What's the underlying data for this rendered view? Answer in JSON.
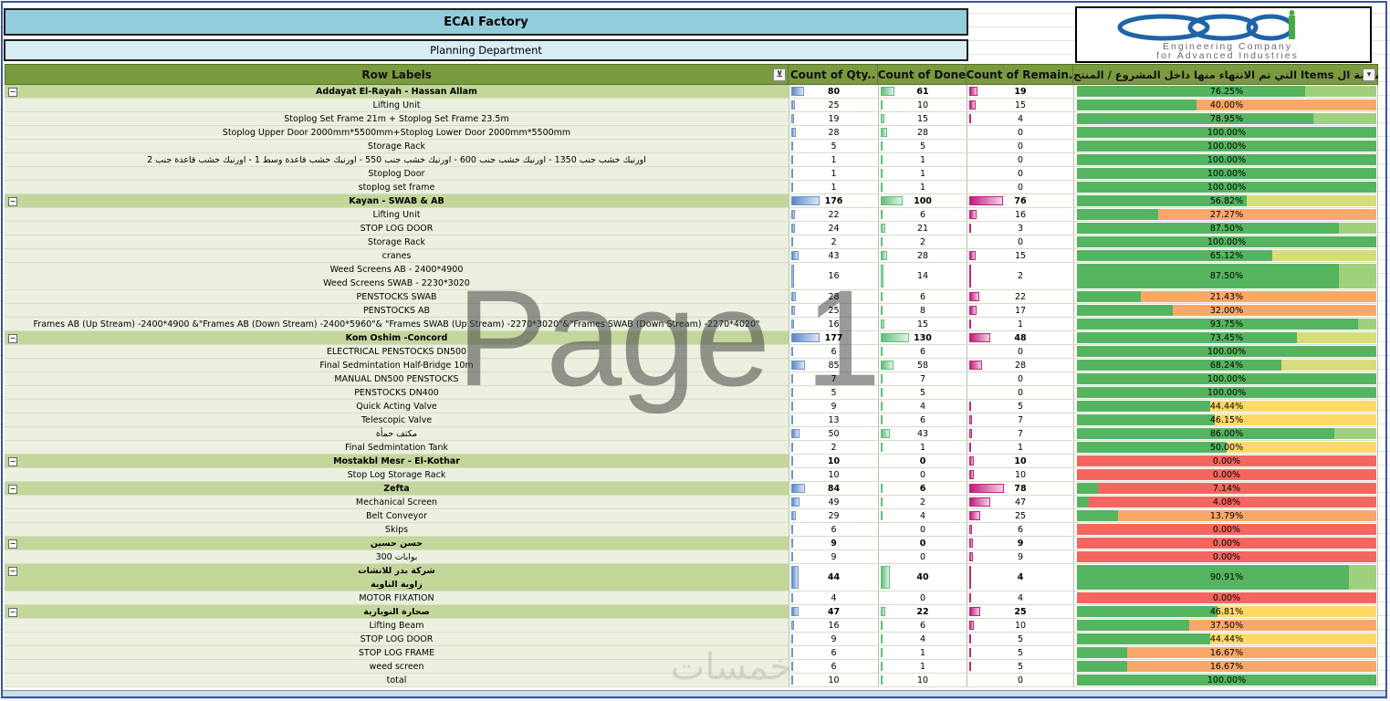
{
  "title": "ECAI Factory",
  "subtitle": "Planning Department",
  "logo": {
    "line1": "Engineering Company",
    "line2": "for Advanced Industries",
    "icon": "ecai-logo-icon",
    "colors": {
      "blue": "#1f63a8",
      "green": "#48a949"
    }
  },
  "headers": {
    "row_labels": "Row Labels",
    "qty": "Count of Qty..",
    "done": "Count of Done",
    "remain": "Count of Remain.",
    "pct": "نسبة ال Items التي تم الانتهاء منها داخل المشروع / المنتج",
    "filter_icon": "filter-icon",
    "dropdown_icon": "chevron-down-icon"
  },
  "max": {
    "qty": 177,
    "done": 130,
    "remain": 78
  },
  "rows": [
    {
      "type": "group",
      "label": "Addayat El-Rayah - Hassan Allam",
      "qty": 80,
      "done": 61,
      "remain": 19,
      "pct": "76.25%",
      "p": 76.25
    },
    {
      "type": "item",
      "label": "Lifting Unit",
      "qty": 25,
      "done": 10,
      "remain": 15,
      "pct": "40.00%",
      "p": 40
    },
    {
      "type": "item",
      "label": "Stoplog Set Frame 21m + Stoplog Set Frame 23.5m",
      "qty": 19,
      "done": 15,
      "remain": 4,
      "pct": "78.95%",
      "p": 78.95
    },
    {
      "type": "item",
      "label": "Stoplog Upper Door 2000mm*5500mm+Stoplog Lower Door 2000mm*5500mm",
      "qty": 28,
      "done": 28,
      "remain": 0,
      "pct": "100.00%",
      "p": 100
    },
    {
      "type": "item",
      "label": "Storage Rack",
      "qty": 5,
      "done": 5,
      "remain": 0,
      "pct": "100.00%",
      "p": 100
    },
    {
      "type": "item",
      "label": "اورنيك خشب جنب 1350 - اورنيك خشب جنب 600 - اورنيك خشب جنب 550 - اورنيك خشب قاعدة وسط 1 - اورنيك خشب قاعدة جنب 2",
      "qty": 1,
      "done": 1,
      "remain": 0,
      "pct": "100.00%",
      "p": 100
    },
    {
      "type": "item",
      "label": "Stoplog Door",
      "qty": 1,
      "done": 1,
      "remain": 0,
      "pct": "100.00%",
      "p": 100
    },
    {
      "type": "item",
      "label": "stoplog set frame",
      "qty": 1,
      "done": 1,
      "remain": 0,
      "pct": "100.00%",
      "p": 100
    },
    {
      "type": "group",
      "label": "Kayan - SWAB & AB",
      "qty": 176,
      "done": 100,
      "remain": 76,
      "pct": "56.82%",
      "p": 56.82
    },
    {
      "type": "item",
      "label": "Lifting Unit",
      "qty": 22,
      "done": 6,
      "remain": 16,
      "pct": "27.27%",
      "p": 27.27
    },
    {
      "type": "item",
      "label": "STOP LOG DOOR",
      "qty": 24,
      "done": 21,
      "remain": 3,
      "pct": "87.50%",
      "p": 87.5
    },
    {
      "type": "item",
      "label": "Storage Rack",
      "qty": 2,
      "done": 2,
      "remain": 0,
      "pct": "100.00%",
      "p": 100
    },
    {
      "type": "item",
      "label": "cranes",
      "qty": 43,
      "done": 28,
      "remain": 15,
      "pct": "65.12%",
      "p": 65.12
    },
    {
      "type": "item",
      "tall": true,
      "label": "Weed Screens AB - 2400*4900",
      "label2": "Weed Screens SWAB - 2230*3020",
      "qty": 16,
      "done": 14,
      "remain": 2,
      "pct": "87.50%",
      "p": 87.5
    },
    {
      "type": "item",
      "label": "PENSTOCKS SWAB",
      "qty": 28,
      "done": 6,
      "remain": 22,
      "pct": "21.43%",
      "p": 21.43
    },
    {
      "type": "item",
      "label": "PENSTOCKS AB",
      "qty": 25,
      "done": 8,
      "remain": 17,
      "pct": "32.00%",
      "p": 32
    },
    {
      "type": "item",
      "label": "Frames AB (Up Stream)  -2400*4900 &\"Frames AB (Down Stream) -2400*5960\"& \"Frames SWAB (Up Stream)  -2270*3020\"&\"Frames SWAB (Down Stream) -2270*4020\"",
      "qty": 16,
      "done": 15,
      "remain": 1,
      "pct": "93.75%",
      "p": 93.75
    },
    {
      "type": "group",
      "label": "Kom Oshim -Concord",
      "qty": 177,
      "done": 130,
      "remain": 48,
      "pct": "73.45%",
      "p": 73.45
    },
    {
      "type": "item",
      "label": "ELECTRICAL PENSTOCKS DN500",
      "qty": 6,
      "done": 6,
      "remain": 0,
      "pct": "100.00%",
      "p": 100
    },
    {
      "type": "item",
      "label": "Final Sedmintation Half-Bridge 10m",
      "qty": 85,
      "done": 58,
      "remain": 28,
      "pct": "68.24%",
      "p": 68.24
    },
    {
      "type": "item",
      "label": "MANUAL DN500 PENSTOCKS",
      "qty": 7,
      "done": 7,
      "remain": 0,
      "pct": "100.00%",
      "p": 100
    },
    {
      "type": "item",
      "label": "PENSTOCKS DN400",
      "qty": 5,
      "done": 5,
      "remain": 0,
      "pct": "100.00%",
      "p": 100
    },
    {
      "type": "item",
      "label": "Quick Acting Valve",
      "qty": 9,
      "done": 4,
      "remain": 5,
      "pct": "44.44%",
      "p": 44.44
    },
    {
      "type": "item",
      "label": "Telescopic Valve",
      "qty": 13,
      "done": 6,
      "remain": 7,
      "pct": "46.15%",
      "p": 46.15
    },
    {
      "type": "item",
      "label": "مكثف حمأة",
      "qty": 50,
      "done": 43,
      "remain": 7,
      "pct": "86.00%",
      "p": 86
    },
    {
      "type": "item",
      "label": "Final Sedmintation Tank",
      "qty": 2,
      "done": 1,
      "remain": 1,
      "pct": "50.00%",
      "p": 50
    },
    {
      "type": "group",
      "label": "Mostakbl Mesr - El-Kothar",
      "qty": 10,
      "done": 0,
      "remain": 10,
      "pct": "0.00%",
      "p": 0
    },
    {
      "type": "item",
      "label": "Stop Log Storage Rack",
      "qty": 10,
      "done": 0,
      "remain": 10,
      "pct": "0.00%",
      "p": 0
    },
    {
      "type": "group",
      "label": "Zefta",
      "qty": 84,
      "done": 6,
      "remain": 78,
      "pct": "7.14%",
      "p": 7.14
    },
    {
      "type": "item",
      "label": "Mechanical Screen",
      "qty": 49,
      "done": 2,
      "remain": 47,
      "pct": "4.08%",
      "p": 4.08
    },
    {
      "type": "item",
      "label": "Belt Conveyor",
      "qty": 29,
      "done": 4,
      "remain": 25,
      "pct": "13.79%",
      "p": 13.79
    },
    {
      "type": "item",
      "label": "Skips",
      "qty": 6,
      "done": 0,
      "remain": 6,
      "pct": "0.00%",
      "p": 0
    },
    {
      "type": "group",
      "label": "حسن حسين",
      "qty": 9,
      "done": 0,
      "remain": 9,
      "pct": "0.00%",
      "p": 0
    },
    {
      "type": "item",
      "label": "بوابات 300",
      "qty": 9,
      "done": 0,
      "remain": 9,
      "pct": "0.00%",
      "p": 0
    },
    {
      "type": "group",
      "tall": true,
      "label": "شركة بدر للانشات",
      "label2": "زاوية الناوية",
      "qty": 44,
      "done": 40,
      "remain": 4,
      "pct": "90.91%",
      "p": 90.91
    },
    {
      "type": "item",
      "label": "MOTOR FIXATION",
      "qty": 4,
      "done": 0,
      "remain": 4,
      "pct": "0.00%",
      "p": 0
    },
    {
      "type": "group",
      "label": "صحارة النوبارية",
      "qty": 47,
      "done": 22,
      "remain": 25,
      "pct": "46.81%",
      "p": 46.81
    },
    {
      "type": "item",
      "label": "Lifting Beam",
      "qty": 16,
      "done": 6,
      "remain": 10,
      "pct": "37.50%",
      "p": 37.5
    },
    {
      "type": "item",
      "label": "STOP LOG DOOR",
      "qty": 9,
      "done": 4,
      "remain": 5,
      "pct": "44.44%",
      "p": 44.44
    },
    {
      "type": "item",
      "label": "STOP LOG FRAME",
      "qty": 6,
      "done": 1,
      "remain": 5,
      "pct": "16.67%",
      "p": 16.67
    },
    {
      "type": "item",
      "label": "weed screen",
      "qty": 6,
      "done": 1,
      "remain": 5,
      "pct": "16.67%",
      "p": 16.67
    },
    {
      "type": "item",
      "label": "total",
      "qty": 10,
      "done": 10,
      "remain": 0,
      "pct": "100.00%",
      "p": 100
    }
  ],
  "watermark": "Page 1",
  "watermark2": "خمسات",
  "pct_colors": {
    "fill": "#54b45f",
    "high": "#6cc26e",
    "mid": "#c9dc75",
    "warm": "#ffd966",
    "orange": "#f8a868",
    "low": "#f4665f"
  }
}
